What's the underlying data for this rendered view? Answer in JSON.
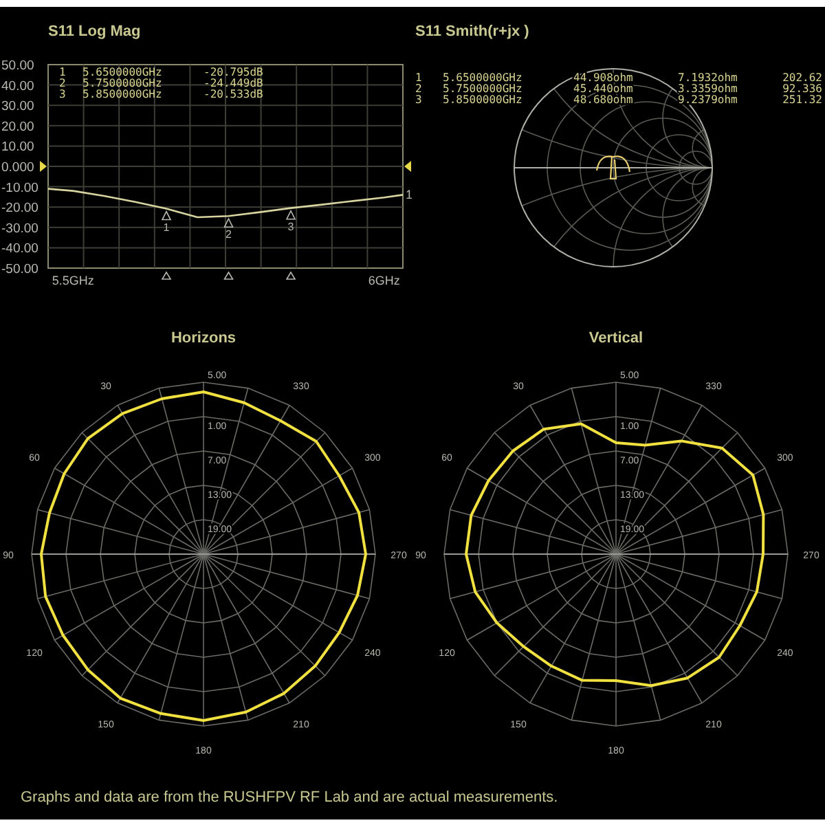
{
  "log_mag": {
    "title": "S11 Log Mag",
    "markers": [
      {
        "number": "1",
        "frequency": "5.6500000GHz",
        "value": "-20.795dB"
      },
      {
        "number": "2",
        "frequency": "5.7500000GHz",
        "value": "-24.449dB"
      },
      {
        "number": "3",
        "frequency": "5.8500000GHz",
        "value": "-20.533dB"
      }
    ],
    "trace_markers": [
      {
        "label": "1"
      },
      {
        "label": "2"
      },
      {
        "label": "3"
      }
    ],
    "trace_end_label": "1",
    "chart_data": {
      "type": "line",
      "x": [
        5.46,
        5.5,
        5.55,
        5.6,
        5.65,
        5.7,
        5.75,
        5.8,
        5.85,
        5.9,
        5.95,
        6,
        6.03
      ],
      "series": [
        {
          "color": "#d8d4a0",
          "values": [
            -11,
            -12,
            -14.5,
            -17.5,
            -20.8,
            -25,
            -24.4,
            -22.5,
            -20.5,
            -18.8,
            -17,
            -15.3,
            -14
          ]
        }
      ],
      "grid": true,
      "xlim": [
        5.46,
        6.03
      ],
      "ylim": [
        -50,
        50
      ],
      "xticks": [
        {
          "value": 5.5,
          "label": "5.5GHz"
        },
        {
          "value": 6,
          "label": "6GHz"
        }
      ],
      "yticks": [
        {
          "value": 50,
          "label": "50.00"
        },
        {
          "value": 40,
          "label": "40.00"
        },
        {
          "value": 30,
          "label": "30.00"
        },
        {
          "value": 20,
          "label": "20.00"
        },
        {
          "value": 10,
          "label": "10.00"
        },
        {
          "value": 0,
          "label": "0.000"
        },
        {
          "value": -10,
          "label": "-10.00"
        },
        {
          "value": -20,
          "label": "-20.00"
        },
        {
          "value": -30,
          "label": "-30.00"
        },
        {
          "value": -40,
          "label": "-40.00"
        },
        {
          "value": -50,
          "label": "-50.00"
        }
      ]
    }
  },
  "smith": {
    "title": "S11 Smith(r+jx )",
    "markers": [
      {
        "number": "1",
        "frequency": "5.6500000GHz",
        "resistance": "44.908ohm",
        "reactance": "7.1932ohm",
        "column_5": "202.62"
      },
      {
        "number": "2",
        "frequency": "5.7500000GHz",
        "resistance": "45.440ohm",
        "reactance": "3.3359ohm",
        "column_5": "92.336"
      },
      {
        "number": "3",
        "frequency": "5.8500000GHz",
        "resistance": "48.680ohm",
        "reactance": "9.2379ohm",
        "column_5": "251.32"
      }
    ]
  },
  "polar_charts": [
    {
      "title": "Horizons",
      "ring_labels": [
        "5.00",
        "1.00",
        "7.00",
        "13.00",
        "19.00"
      ],
      "angle_labels": [
        "30",
        "60",
        "90",
        "120",
        "150",
        "180",
        "210",
        "240",
        "270",
        "300",
        "330"
      ],
      "kind": "horizontal"
    },
    {
      "title": "Vertical",
      "ring_labels": [
        "5.00",
        "1.00",
        "7.00",
        "13.00",
        "19.00"
      ],
      "angle_labels": [
        "30",
        "60",
        "90",
        "120",
        "150",
        "180",
        "210",
        "240",
        "270",
        "300",
        "330"
      ],
      "kind": "vertical"
    }
  ],
  "footer": "Graphs and data are from the RUSHFPV RF Lab and are actual measurements."
}
